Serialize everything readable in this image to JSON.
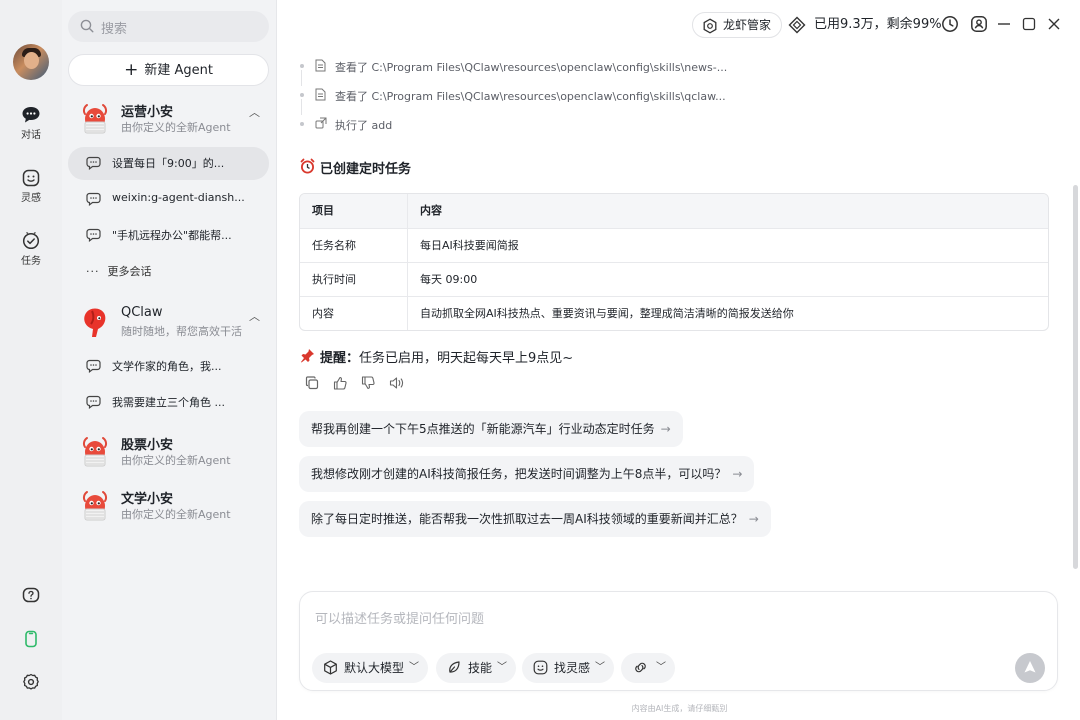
{
  "rail": {
    "items": [
      {
        "label": "对话",
        "icon": "chat-icon"
      },
      {
        "label": "灵感",
        "icon": "smile-icon"
      },
      {
        "label": "任务",
        "icon": "task-check-icon"
      }
    ],
    "bottom_icons": [
      "help-icon",
      "phone-icon",
      "settings-icon"
    ]
  },
  "sidebar": {
    "search_placeholder": "搜索",
    "new_agent_label": "新建 Agent",
    "agents": [
      {
        "name": "运营小安",
        "desc": "由你定义的全新Agent",
        "expanded": true
      },
      {
        "name": "QClaw",
        "desc": "随时随地，帮您高效干活",
        "expanded": true
      },
      {
        "name": "股票小安",
        "desc": "由你定义的全新Agent"
      },
      {
        "name": "文学小安",
        "desc": "由你定义的全新Agent"
      }
    ],
    "conversations_group1": [
      "设置每日「9:00」的...",
      "weixin:g-agent-diansh...",
      "\"手机远程办公\"都能帮..."
    ],
    "more_label": "更多会话",
    "conversations_group2": [
      "文学作家的角色，我...",
      "我需要建立三个角色 ..."
    ]
  },
  "topbar": {
    "assistant_label": "龙虾管家",
    "usage_label": "已用9.3万，剩余99%"
  },
  "log": [
    {
      "icon": "file-icon",
      "text": "查看了 C:\\Program Files\\QClaw\\resources\\openclaw\\config\\skills\\news-..."
    },
    {
      "icon": "file-icon",
      "text": "查看了 C:\\Program Files\\QClaw\\resources\\openclaw\\config\\skills\\qclaw..."
    },
    {
      "icon": "exec-icon",
      "text": "执行了 add"
    }
  ],
  "result": {
    "title": "已创建定时任务",
    "table": {
      "headers": [
        "项目",
        "内容"
      ],
      "rows": [
        [
          "任务名称",
          "每日AI科技要闻简报"
        ],
        [
          "执行时间",
          "每天 09:00"
        ],
        [
          "内容",
          "自动抓取全网AI科技热点、重要资讯与要闻，整理成简洁清晰的简报发送给你"
        ]
      ]
    },
    "reminder_bold": "提醒：",
    "reminder_text": "任务已启用，明天起每天早上9点见~"
  },
  "suggestions": [
    "帮我再创建一个下午5点推送的「新能源汽车」行业动态定时任务",
    "我想修改刚才创建的AI科技简报任务，把发送时间调整为上午8点半，可以吗？",
    "除了每日定时推送，能否帮我一次性抓取过去一周AI科技领域的重要新闻并汇总？"
  ],
  "composer": {
    "placeholder": "可以描述任务或提问任何问题",
    "model_label": "默认大模型",
    "skill_label": "技能",
    "inspiration_label": "找灵感"
  },
  "footnote": "内容由AI生成，请仔细甄别",
  "colors": {
    "accent_green": "#2fba6a",
    "border": "#e4e5e8",
    "sidebar_bg": "#f2f3f5"
  }
}
